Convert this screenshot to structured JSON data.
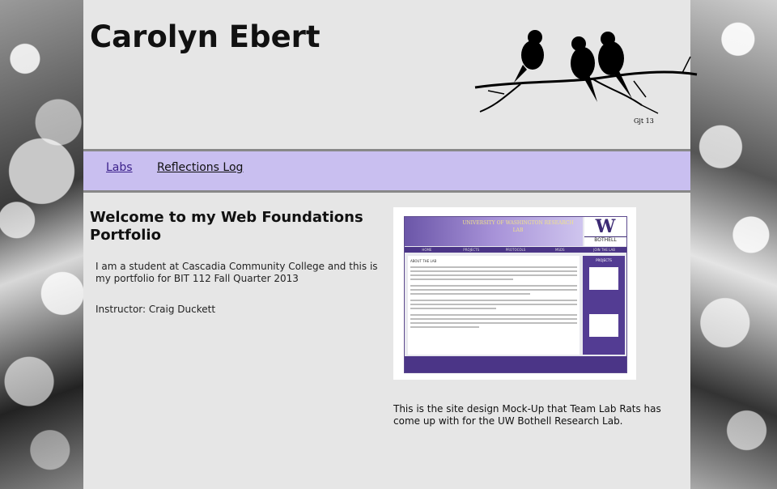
{
  "header": {
    "site_title": "Carolyn Ebert",
    "artwork_signature": "Gjt 13"
  },
  "nav": {
    "items": [
      {
        "label": "Labs"
      },
      {
        "label": "Reflections Log"
      }
    ]
  },
  "main": {
    "welcome_heading": "Welcome to my Web Foundations Portfolio",
    "intro_text": "I am a student at Cascadia Community College and this is my portfolio for BIT 112 Fall Quarter 2013",
    "instructor_text": "Instructor: Craig Duckett"
  },
  "mockup": {
    "banner_text": "UNIVERSITY OF WASHINGTON RESEARCH LAB",
    "logo_letter": "W",
    "logo_text": "BOTHELL",
    "nav_items": [
      "HOME",
      "PROJECTS",
      "PROTOCOLS",
      "MSDS",
      "JOIN THE LAB"
    ],
    "about_heading": "ABOUT THE LAB",
    "side_heading": "PROJECTS",
    "caption": "This is the site design Mock-Up that Team Lab Rats has come up with for the UW Bothell Research Lab."
  },
  "colors": {
    "nav_bg": "#c9bff0",
    "page_bg": "#e6e6e6",
    "uw_purple": "#4b3587"
  }
}
